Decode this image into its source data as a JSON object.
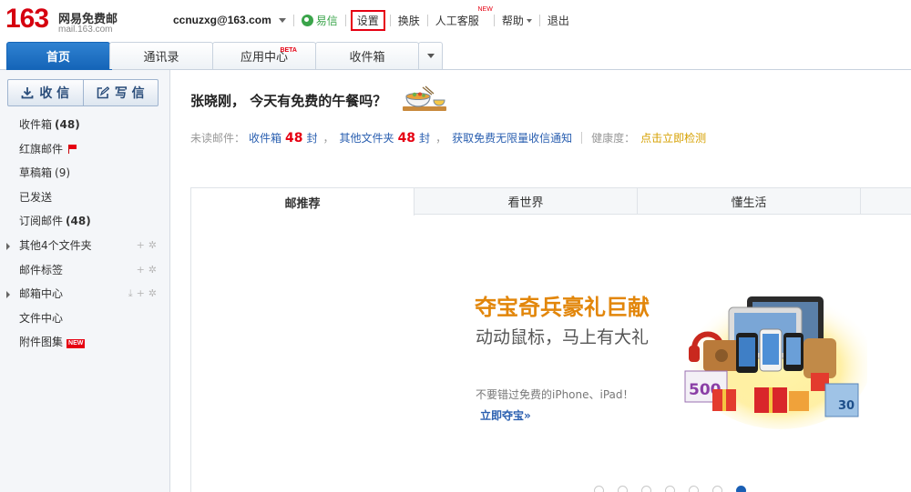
{
  "logo": {
    "number": "163",
    "name": "网易免费邮",
    "url": "mail.163.com"
  },
  "topbar": {
    "account": "ccnuzxg@163.com",
    "links": {
      "yixin": "易信",
      "settings": "设置",
      "skin": "换肤",
      "support": "人工客服",
      "support_badge": "NEW",
      "help": "帮助",
      "logout": "退出"
    }
  },
  "tabs": {
    "home": "首页",
    "contacts": "通讯录",
    "apps": "应用中心",
    "apps_badge": "BETA",
    "inbox": "收件箱"
  },
  "sidebar": {
    "receive": "收 信",
    "compose": "写 信",
    "folders": [
      {
        "label": "收件箱",
        "count": "(48)"
      },
      {
        "label": "红旗邮件"
      },
      {
        "label": "草稿箱",
        "count": "(9)"
      },
      {
        "label": "已发送"
      },
      {
        "label": "订阅邮件",
        "count": "(48)"
      },
      {
        "label": "其他4个文件夹"
      },
      {
        "label": "邮件标签"
      },
      {
        "label": "邮箱中心"
      },
      {
        "label": "文件中心"
      },
      {
        "label": "附件图集",
        "badge": "NEW"
      }
    ]
  },
  "main": {
    "greeting": "张晓刚， 今天有免费的午餐吗？",
    "unread": {
      "label": "未读邮件：",
      "inbox": "收件箱",
      "inbox_count": "48",
      "unit": "封",
      "comma": "，",
      "other": "其他文件夹",
      "other_count": "48",
      "notify": "获取免费无限量收信通知",
      "health_label": "健康度：",
      "health_link": "点击立即检测"
    },
    "content_tabs": [
      "邮推荐",
      "看世界",
      "懂生活"
    ],
    "promo": {
      "title": "夺宝奇兵豪礼巨献",
      "subtitle": "动动鼠标，马上有大礼",
      "note": "不要错过免费的iPhone、iPad！",
      "link": "立即夺宝»",
      "coupon_value": "500",
      "box_value": "30"
    }
  },
  "colors": {
    "brand_red": "#d6000f",
    "tab_blue": "#1565b8",
    "link_blue": "#2a5fb0",
    "promo_orange": "#e2860a"
  }
}
